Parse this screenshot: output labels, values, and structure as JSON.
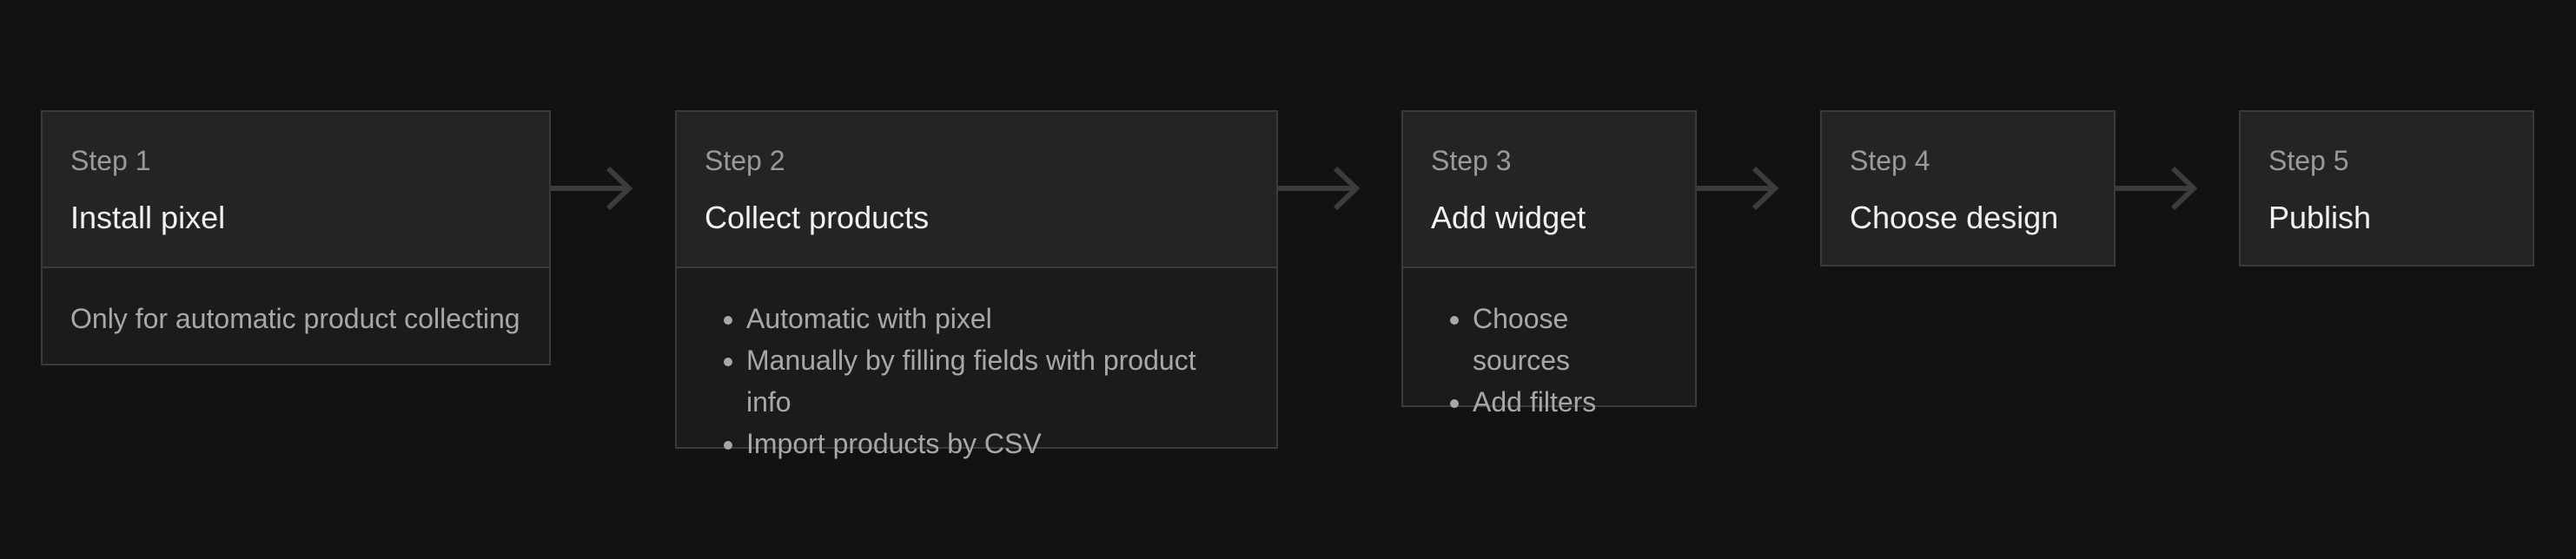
{
  "steps": [
    {
      "number": "Step 1",
      "title": "Install pixel",
      "note": "Only for automatic product collecting"
    },
    {
      "number": "Step 2",
      "title": "Collect products",
      "items": [
        "Automatic with pixel",
        "Manually by filling fields with product info",
        "Import products by CSV"
      ]
    },
    {
      "number": "Step 3",
      "title": "Add widget",
      "items": [
        "Choose sources",
        "Add filters"
      ]
    },
    {
      "number": "Step 4",
      "title": "Choose design"
    },
    {
      "number": "Step 5",
      "title": "Publish"
    }
  ],
  "colors": {
    "background": "#121212",
    "card_header": "#242424",
    "card_body": "#1b1b1b",
    "border": "#3a3a3a",
    "arrow": "#3c3c3c",
    "title_text": "#f2f2f2",
    "muted_text": "#a8a8a8"
  }
}
